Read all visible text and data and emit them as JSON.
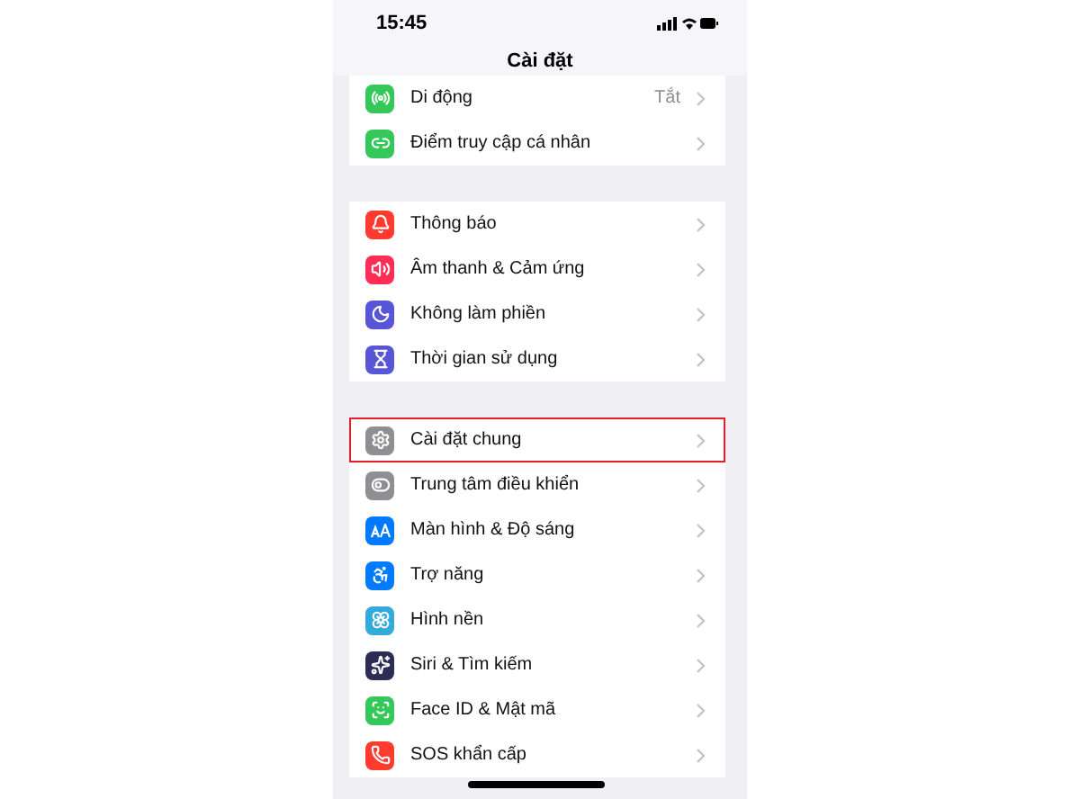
{
  "status_bar": {
    "time": "15:45"
  },
  "title": "Cài đặt",
  "groups": [
    {
      "items": [
        {
          "label": "Di động",
          "value": "Tắt",
          "color": "#34c759",
          "highlighted": false
        },
        {
          "label": "Điểm truy cập cá nhân",
          "color": "#34c759",
          "highlighted": false
        }
      ]
    },
    {
      "items": [
        {
          "label": "Thông báo",
          "color": "#ff3b30",
          "highlighted": false
        },
        {
          "label": "Âm thanh & Cảm ứng",
          "color": "#ff2d55",
          "highlighted": false
        },
        {
          "label": "Không làm phiền",
          "color": "#5856d6",
          "highlighted": false
        },
        {
          "label": "Thời gian sử dụng",
          "color": "#5856d6",
          "highlighted": false
        }
      ]
    },
    {
      "items": [
        {
          "label": "Cài đặt chung",
          "color": "#8e8e93",
          "highlighted": true
        },
        {
          "label": "Trung tâm điều khiển",
          "color": "#8e8e93",
          "highlighted": false
        },
        {
          "label": "Màn hình & Độ sáng",
          "color": "#007aff",
          "highlighted": false
        },
        {
          "label": "Trợ năng",
          "color": "#007aff",
          "highlighted": false
        },
        {
          "label": "Hình nền",
          "color": "#34aadc",
          "highlighted": false
        },
        {
          "label": "Siri & Tìm kiếm",
          "color": "#2c2c54",
          "highlighted": false
        },
        {
          "label": "Face ID & Mật mã",
          "color": "#34c759",
          "highlighted": false
        },
        {
          "label": "SOS khẩn cấp",
          "color": "#ff3b30",
          "highlighted": false
        }
      ]
    }
  ]
}
